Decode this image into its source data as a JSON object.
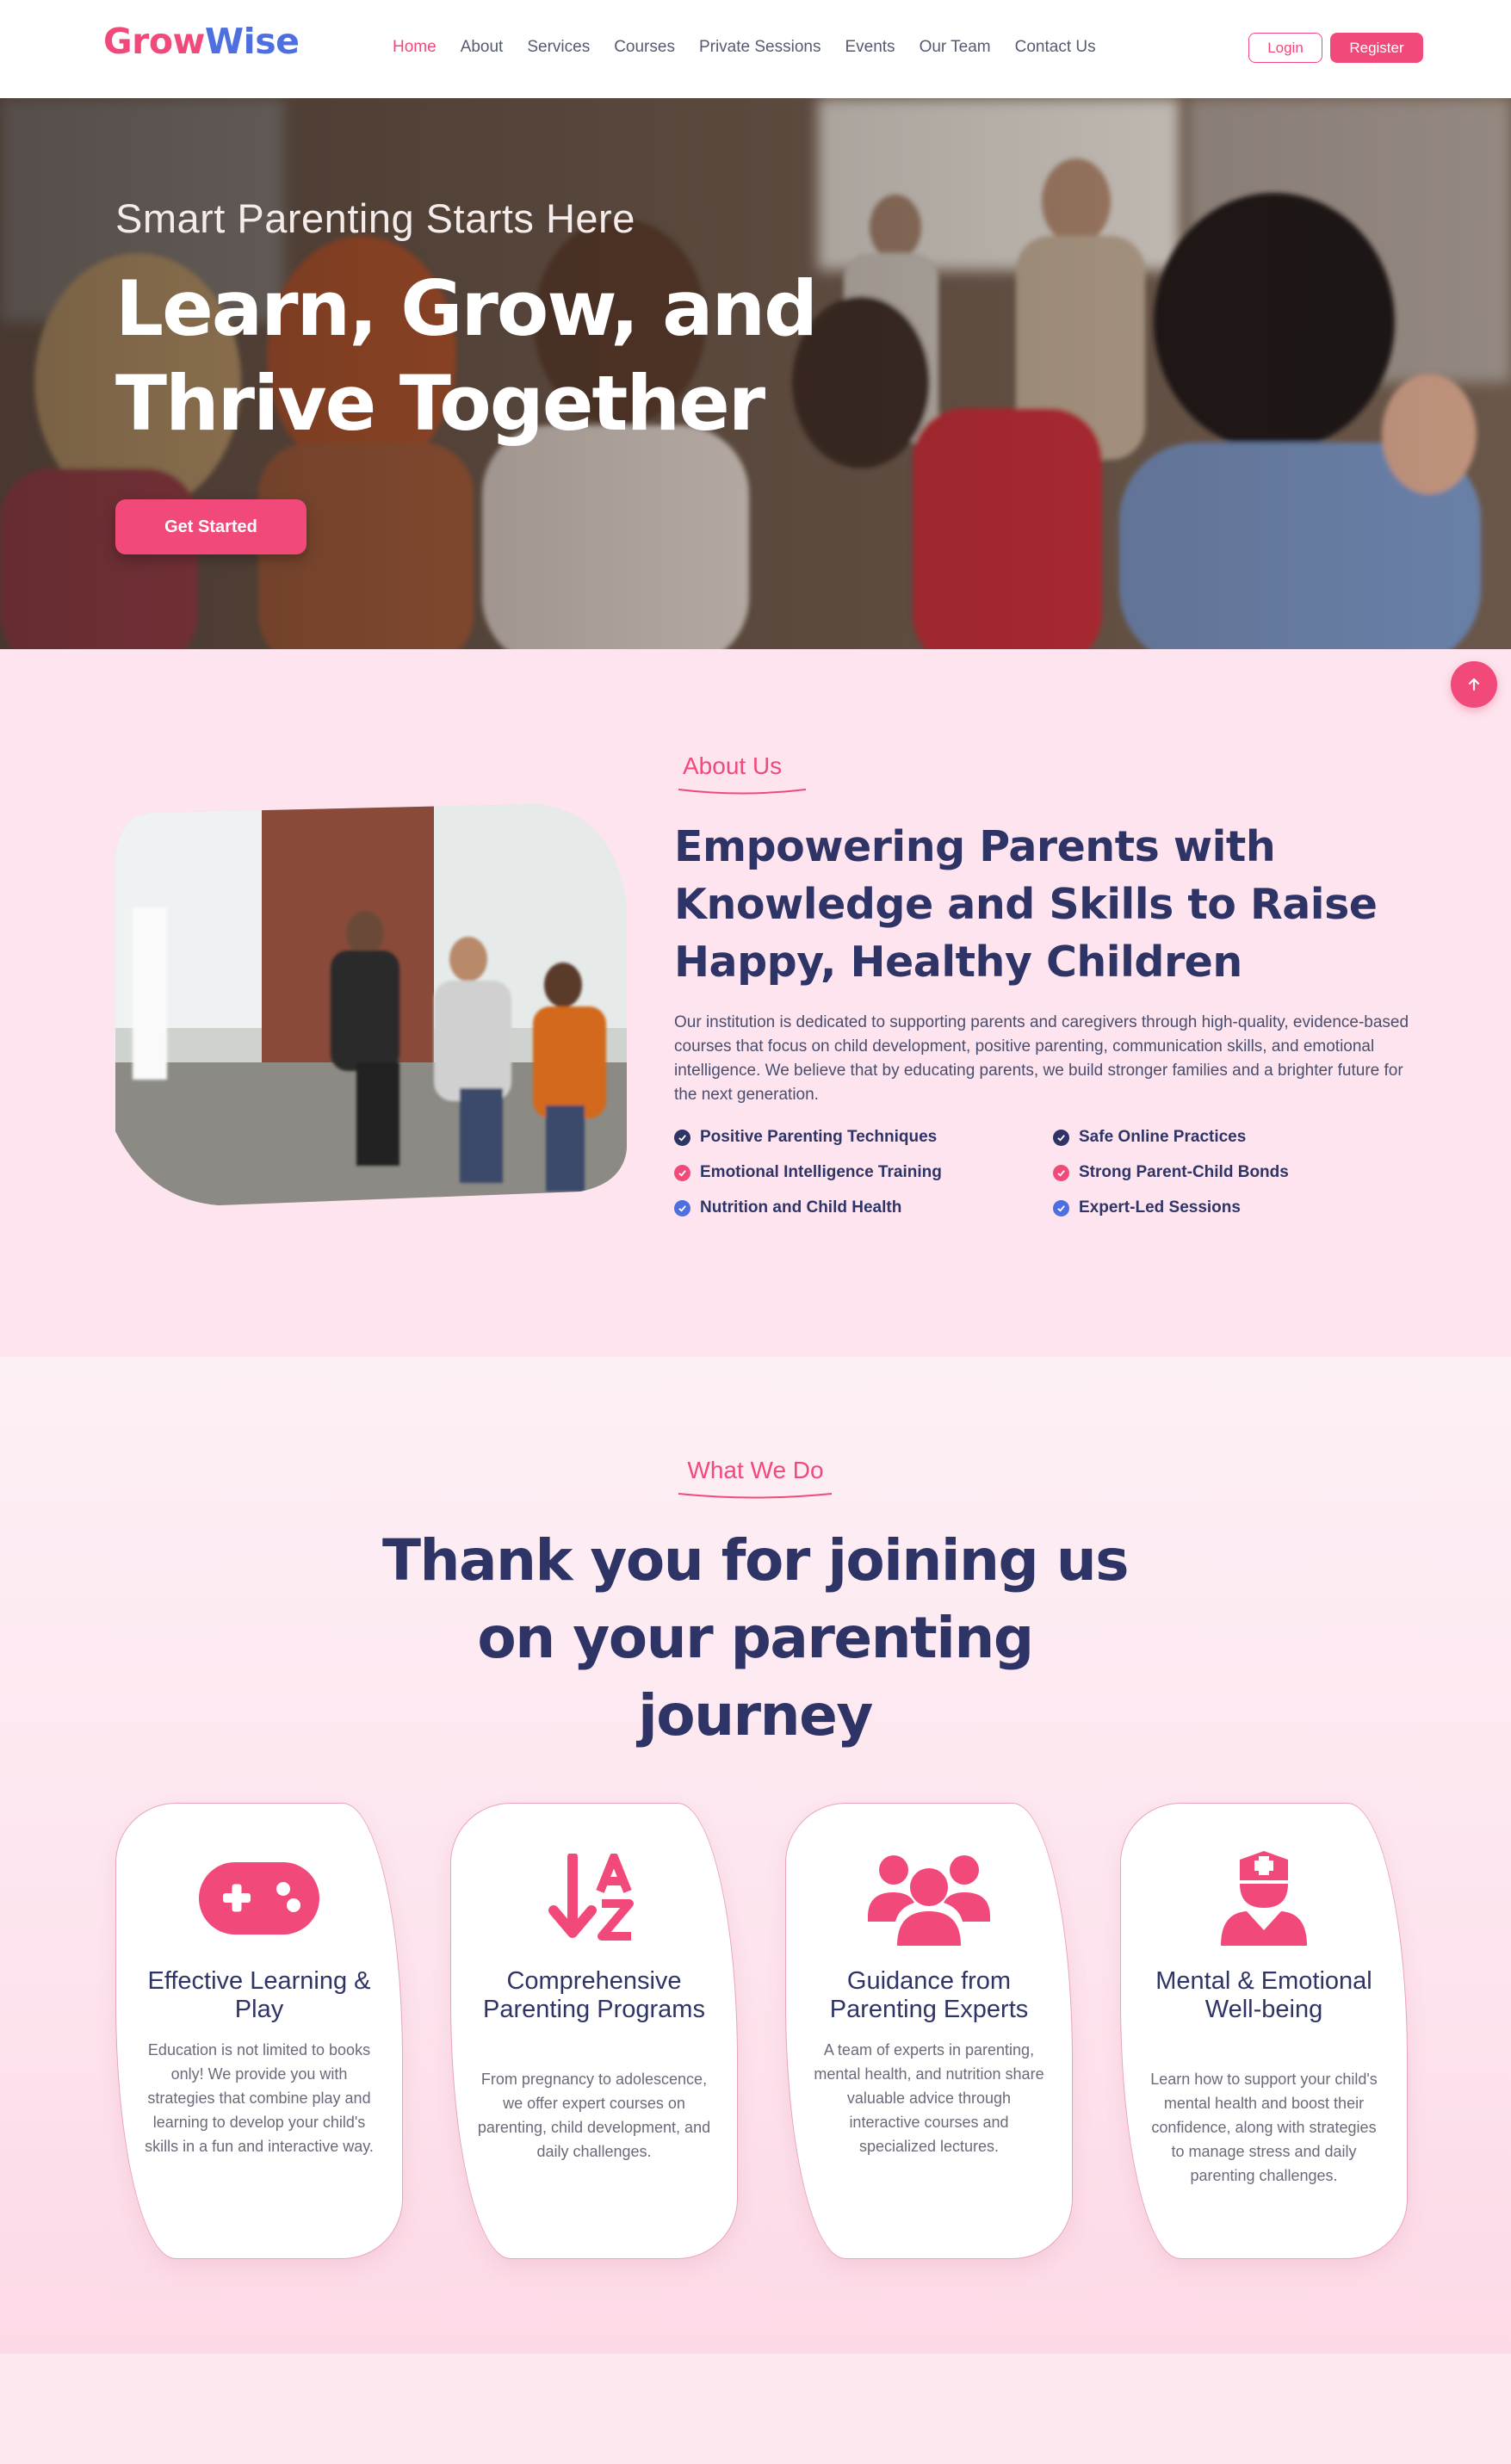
{
  "brand": {
    "name_part1": "Grow",
    "name_part2": "Wise"
  },
  "nav": {
    "items": [
      "Home",
      "About",
      "Services",
      "Courses",
      "Private Sessions",
      "Events",
      "Our Team",
      "Contact Us"
    ],
    "active": "Home",
    "login_label": "Login",
    "register_label": "Register"
  },
  "hero": {
    "subtitle": "Smart Parenting Starts Here",
    "title_line1": "Learn, Grow, and",
    "title_line2": "Thrive Together",
    "cta_label": "Get Started"
  },
  "about": {
    "eyebrow": "About Us",
    "title_line1": "Empowering Parents with",
    "title_line2": "Knowledge and Skills to Raise",
    "title_line3": "Happy, Healthy Children",
    "description": "Our institution is dedicated to supporting parents and caregivers through high-quality, evidence-based courses that focus on child development, positive parenting, communication skills, and emotional intelligence. We believe that by educating parents, we build stronger families and a brighter future for the next generation.",
    "features": [
      {
        "label": "Positive Parenting Techniques",
        "color": "#2f3466"
      },
      {
        "label": "Safe Online Practices",
        "color": "#2f3466"
      },
      {
        "label": "Emotional Intelligence Training",
        "color": "#f2497b"
      },
      {
        "label": "Strong Parent-Child Bonds",
        "color": "#f2497b"
      },
      {
        "label": "Nutrition and Child Health",
        "color": "#4e6fe0"
      },
      {
        "label": "Expert-Led Sessions",
        "color": "#4e6fe0"
      }
    ]
  },
  "services": {
    "eyebrow": "What We Do",
    "title_line1": "Thank you for joining us",
    "title_line2": "on your parenting",
    "title_line3": "journey",
    "cards": [
      {
        "icon": "gamepad-icon",
        "title": "Effective Learning & Play",
        "text": "Education is not limited to books only! We provide you with strategies that combine play and learning to develop your child's skills in a fun and interactive way."
      },
      {
        "icon": "sort-alpha-icon",
        "title": "Comprehensive Parenting Programs",
        "text": "From pregnancy to adolescence, we offer expert courses on parenting, child development, and daily challenges."
      },
      {
        "icon": "users-icon",
        "title": "Guidance from Parenting Experts",
        "text": "A team of experts in parenting, mental health, and nutrition share valuable advice through interactive courses and specialized lectures."
      },
      {
        "icon": "nurse-icon",
        "title": "Mental & Emotional Well-being",
        "text": "Learn how to support your child's mental health and boost their confidence, along with strategies to manage stress and daily parenting challenges."
      }
    ]
  },
  "colors": {
    "accent": "#f2497b",
    "brand_blue": "#4e6fe0",
    "heading": "#2f3466",
    "section_bg": "#fde4ee"
  }
}
